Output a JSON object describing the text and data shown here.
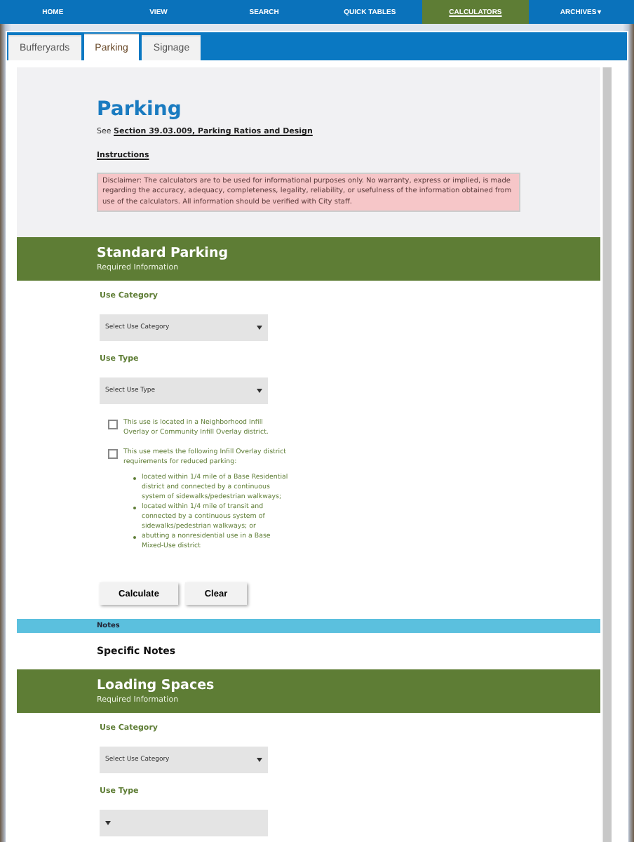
{
  "nav": [
    {
      "label": "HOME",
      "selected": false
    },
    {
      "label": "VIEW",
      "selected": false
    },
    {
      "label": "SEARCH",
      "selected": false
    },
    {
      "label": "QUICK TABLES",
      "selected": false
    },
    {
      "label": "CALCULATORS",
      "selected": true
    },
    {
      "label": "ARCHIVES",
      "selected": false,
      "caret": "▾"
    }
  ],
  "tabs": [
    {
      "label": "Bufferyards",
      "selected": false
    },
    {
      "label": "Parking",
      "selected": true
    },
    {
      "label": "Signage",
      "selected": false
    }
  ],
  "header": {
    "title": "Parking",
    "see_prefix": "See",
    "see_link": "Section 39.03.009, Parking Ratios and Design",
    "instructions_link": "Instructions",
    "disclaimer": "Disclaimer: The calculators are to be used for informational purposes only. No warranty, express or implied, is made regarding the accuracy, adequacy, completeness, legality, reliability, or usefulness of the information obtained from use of the calculators. All information should be verified with City staff."
  },
  "standard_parking": {
    "title": "Standard Parking",
    "subtitle": "Required Information",
    "fields": [
      {
        "label": "Use Category",
        "placeholder": "Select Use Category"
      },
      {
        "label": "Use Type",
        "placeholder": "Select Use Type"
      }
    ],
    "checkboxes": [
      {
        "label": "This use is located in a Neighborhood Infill Overlay or Community Infill Overlay district.",
        "checked": false
      },
      {
        "label": "This use meets the following Infill Overlay district requirements for reduced parking:",
        "checked": false,
        "bullets": [
          "located within 1/4 mile of a Base Residential district and connected by a continuous system of sidewalks/pedestrian walkways;",
          "located within 1/4 mile of transit and connected by a continuous system of sidewalks/pedestrian walkways; or",
          "abutting a nonresidential use in a Base Mixed-Use district"
        ]
      }
    ],
    "buttons": [
      "Calculate",
      "Clear"
    ]
  },
  "notes": {
    "band": "Notes",
    "heading": "Specific Notes"
  },
  "loading_spaces": {
    "title": "Loading Spaces",
    "subtitle": "Required Information",
    "fields": [
      {
        "label": "Use Category",
        "placeholder": "Select Use Category"
      },
      {
        "label": "Use Type"
      }
    ]
  }
}
